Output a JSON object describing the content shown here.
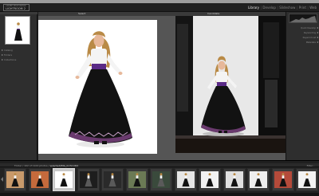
{
  "app": {
    "logo_top": "ADOBE PHOTOSHOP",
    "logo_bottom": "LIGHTROOM 2"
  },
  "modules": [
    "Library",
    "Develop",
    "Slideshow",
    "Print",
    "Web"
  ],
  "active_module": "Library",
  "left_panel": {
    "navigator_label": "Navigator",
    "sections": [
      "Catalog",
      "Folders",
      "Collections"
    ]
  },
  "right_panel": {
    "sections": [
      "Quick Develop",
      "Keywording",
      "Keyword List",
      "Metadata"
    ]
  },
  "compare": {
    "select_label": "Select",
    "candidate_label": "Candidate"
  },
  "filmstrip": {
    "path_prefix": "Folder / 102 of 1100 photos /",
    "current_file": "selected/IMG_0172.CR2",
    "filter_label": "Filter :",
    "thumbs": [
      {
        "bg": "#c99a6b"
      },
      {
        "bg": "#c46a3c"
      },
      {
        "bg": "#ffffff",
        "selected": true
      },
      {
        "bg": "#1d1d1d"
      },
      {
        "bg": "#2a2a2a"
      },
      {
        "bg": "#6b7a55"
      },
      {
        "bg": "#3a4a3c"
      },
      {
        "bg": "#e6e6e6"
      },
      {
        "bg": "#f2f2f2"
      },
      {
        "bg": "#e0e0e0"
      },
      {
        "bg": "#eeeeee"
      },
      {
        "bg": "#b44a3a"
      },
      {
        "bg": "#f3f3f3"
      }
    ]
  },
  "colors": {
    "dress": "#121212",
    "apron_band": "#5a2a86",
    "blouse": "#f4f4f4",
    "hair": "#b98a46",
    "skin": "#e7b89a",
    "studio_wall": "#e4e4e4",
    "dark_bg": "#111111"
  }
}
